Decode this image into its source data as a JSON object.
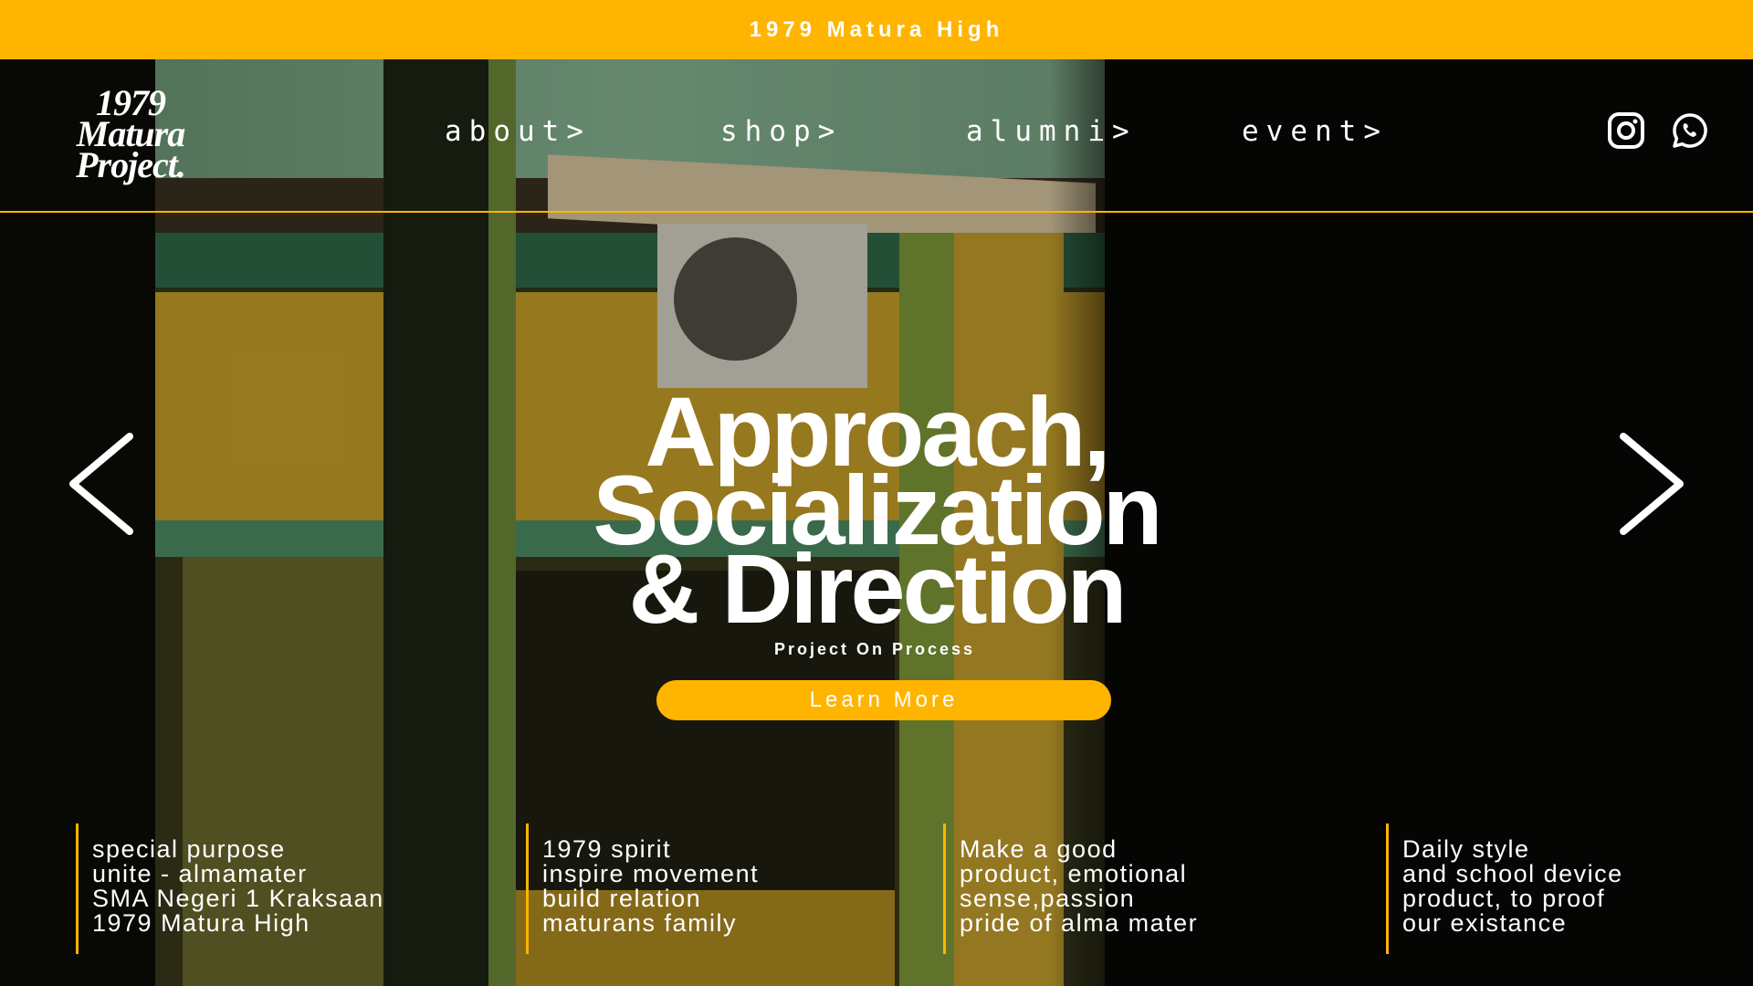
{
  "banner": {
    "title": "1979 Matura High"
  },
  "logo": {
    "lines": [
      "1979",
      "Matura",
      "Project."
    ]
  },
  "nav": [
    {
      "label": "about>"
    },
    {
      "label": "shop>"
    },
    {
      "label": "alumni>"
    },
    {
      "label": "event>"
    }
  ],
  "social": [
    "instagram-icon",
    "whatsapp-icon"
  ],
  "hero": {
    "title_lines": [
      "Approach,",
      "Socialization",
      "& Direction"
    ],
    "subtitle": "Project On Process",
    "button": "Learn More"
  },
  "features": [
    {
      "lines": [
        "special purpose",
        "unite - almamater",
        "SMA Negeri 1 Kraksaan",
        "1979 Matura High"
      ]
    },
    {
      "lines": [
        "1979 spirit",
        "inspire movement",
        "build relation",
        "maturans family"
      ]
    },
    {
      "lines": [
        "Make a good",
        "product, emotional",
        "sense,passion",
        "pride of alma mater"
      ]
    },
    {
      "lines": [
        "Daily style",
        "and school device",
        "product, to proof",
        "our existance"
      ]
    }
  ],
  "colors": {
    "accent": "#FFB500",
    "background": "#050503"
  }
}
